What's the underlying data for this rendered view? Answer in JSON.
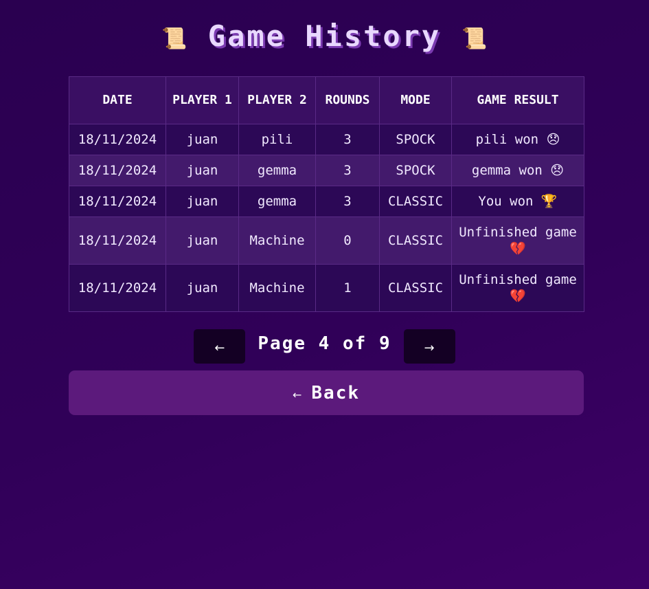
{
  "header": {
    "title": "Game History",
    "left_icon": "📜",
    "right_icon": "📜"
  },
  "table": {
    "columns": [
      "DATE",
      "PLAYER 1",
      "PLAYER 2",
      "ROUNDS",
      "MODE",
      "GAME RESULT"
    ],
    "rows": [
      {
        "date": "18/11/2024",
        "player1": "juan",
        "player2": "pili",
        "rounds": "3",
        "mode": "SPOCK",
        "result": "pili won",
        "result_icon": "😞"
      },
      {
        "date": "18/11/2024",
        "player1": "juan",
        "player2": "gemma",
        "rounds": "3",
        "mode": "SPOCK",
        "result": "gemma won",
        "result_icon": "😞"
      },
      {
        "date": "18/11/2024",
        "player1": "juan",
        "player2": "gemma",
        "rounds": "3",
        "mode": "CLASSIC",
        "result": "You won",
        "result_icon": "🏆"
      },
      {
        "date": "18/11/2024",
        "player1": "juan",
        "player2": "Machine",
        "rounds": "0",
        "mode": "CLASSIC",
        "result": "Unfinished game",
        "result_icon": "💔"
      },
      {
        "date": "18/11/2024",
        "player1": "juan",
        "player2": "Machine",
        "rounds": "1",
        "mode": "CLASSIC",
        "result": "Unfinished game",
        "result_icon": "💔"
      }
    ]
  },
  "pagination": {
    "prev_label": "←",
    "next_label": "→",
    "page_text": "Page 4 of 9"
  },
  "back": {
    "arrow": "←",
    "label": "Back"
  },
  "colors": {
    "background": "#300058",
    "title": "#e9d8ff",
    "back_button": "#5c1a7c",
    "pager_button": "#140024"
  }
}
